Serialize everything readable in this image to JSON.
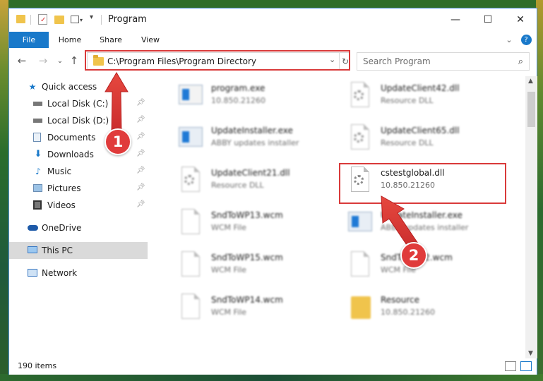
{
  "window": {
    "title": "Program",
    "minimize_glyph": "—",
    "maximize_glyph": "☐",
    "close_glyph": "✕"
  },
  "ribbon": {
    "tabs": [
      "File",
      "Home",
      "Share",
      "View"
    ],
    "collapse_glyph": "⌄",
    "help_glyph": "?"
  },
  "address": {
    "path": "C:\\Program Files\\Program Directory",
    "dropdown_glyph": "⌄",
    "refresh_glyph": "↻"
  },
  "nav_buttons": {
    "back": "←",
    "forward": "→",
    "recent": "⌄",
    "up": "↑"
  },
  "search": {
    "placeholder": "Search Program",
    "icon": "search-icon"
  },
  "sidebar": {
    "items": [
      {
        "label": "Quick access",
        "icon": "star-icon",
        "pinned": false
      },
      {
        "label": "Local Disk (C:)",
        "icon": "drive-icon",
        "pinned": true
      },
      {
        "label": "Local Disk (D:)",
        "icon": "drive-icon",
        "pinned": true
      },
      {
        "label": "Documents",
        "icon": "documents-icon",
        "pinned": true
      },
      {
        "label": "Downloads",
        "icon": "download-icon",
        "pinned": true
      },
      {
        "label": "Music",
        "icon": "music-icon",
        "pinned": true
      },
      {
        "label": "Pictures",
        "icon": "pictures-icon",
        "pinned": true
      },
      {
        "label": "Videos",
        "icon": "videos-icon",
        "pinned": true
      },
      {
        "label": "OneDrive",
        "icon": "cloud-icon",
        "pinned": false
      },
      {
        "label": "This PC",
        "icon": "computer-icon",
        "pinned": false,
        "selected": true
      },
      {
        "label": "Network",
        "icon": "network-icon",
        "pinned": false
      }
    ]
  },
  "files": [
    {
      "name": "program.exe",
      "desc": "10.850.21260",
      "type": "exe"
    },
    {
      "name": "UpdateClient42.dll",
      "desc": "Resource DLL",
      "type": "dll"
    },
    {
      "name": "UpdateInstaller.exe",
      "desc": "ABBY updates installer",
      "type": "exe"
    },
    {
      "name": "UpdateClient65.dll",
      "desc": "Resource DLL",
      "type": "dll"
    },
    {
      "name": "UpdateClient21.dll",
      "desc": "Resource DLL",
      "type": "dll"
    },
    {
      "name": "cstestglobal.dll",
      "desc": "10.850.21260",
      "type": "dll",
      "highlighted": true
    },
    {
      "name": "SndToWP13.wcm",
      "desc": "WCM File",
      "type": "doc"
    },
    {
      "name": "UpdateInstaller.exe",
      "desc": "ABBY updates installer",
      "type": "exe"
    },
    {
      "name": "SndToWP15.wcm",
      "desc": "WCM File",
      "type": "doc"
    },
    {
      "name": "SndToWP12.wcm",
      "desc": "WCM File",
      "type": "doc"
    },
    {
      "name": "SndToWP14.wcm",
      "desc": "WCM File",
      "type": "doc"
    },
    {
      "name": "Resource",
      "desc": "10.850.21260",
      "type": "folder"
    }
  ],
  "status": {
    "item_count": "190 items"
  },
  "annotations": {
    "callout_1": "1",
    "callout_2": "2",
    "color": "#e03b3b"
  }
}
